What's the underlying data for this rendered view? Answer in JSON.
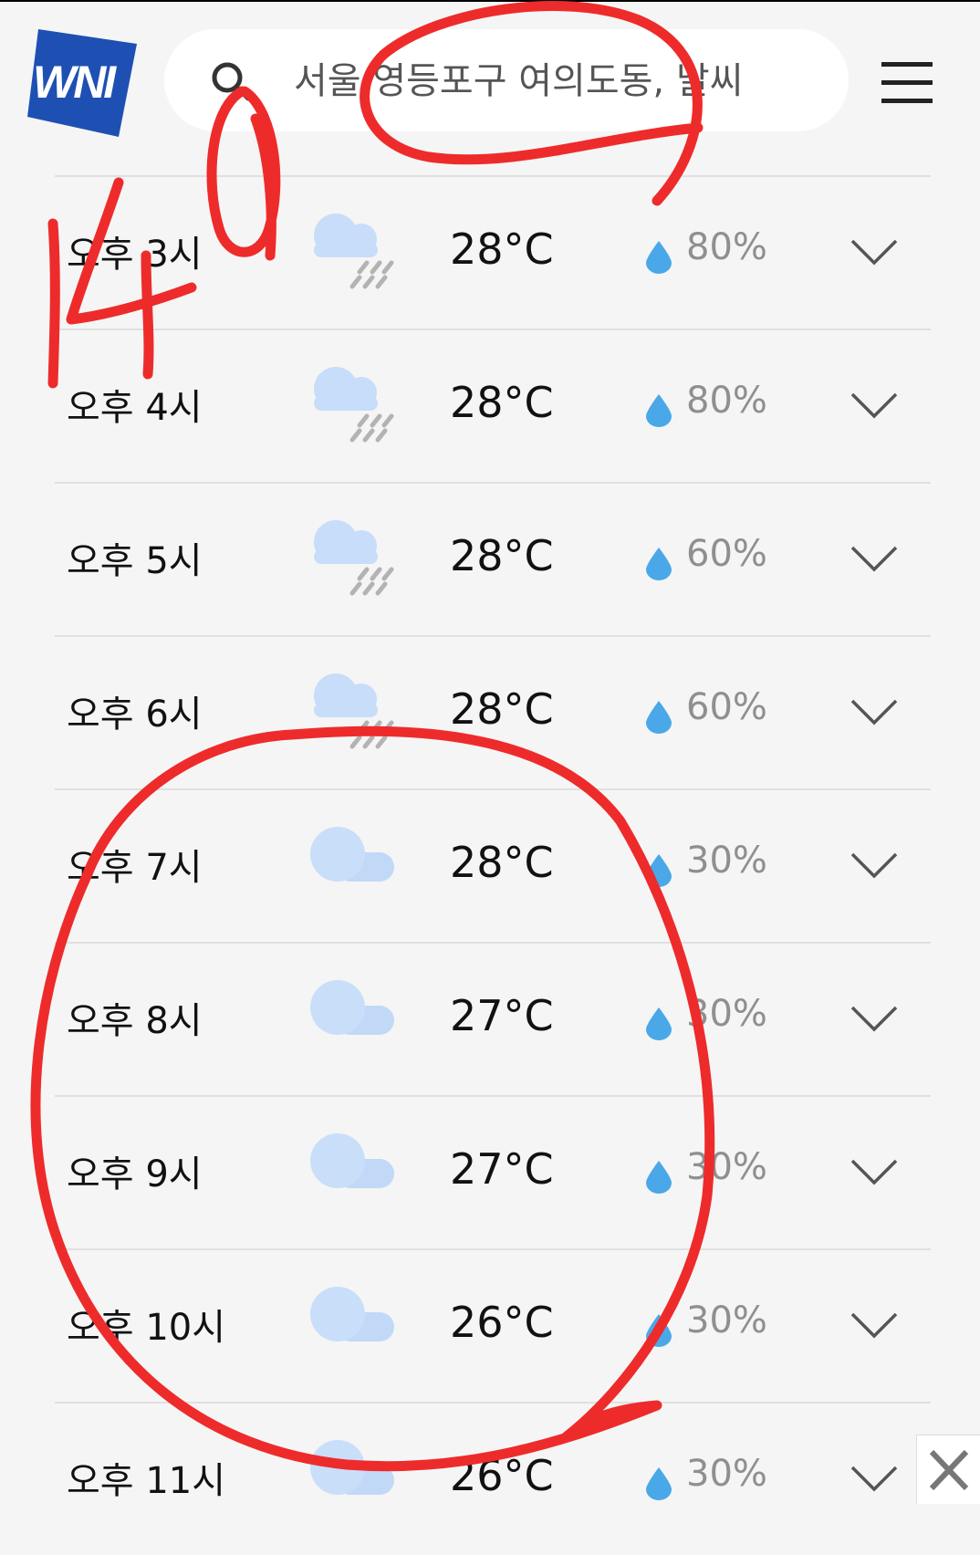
{
  "header": {
    "logo_text": "WNI",
    "search_placeholder": "서울 영등포구 여의도동, 날씨"
  },
  "hours": [
    {
      "time": "오후 3시",
      "icon": "cloud-rain-icon",
      "temp": "28°C",
      "precip": "80%"
    },
    {
      "time": "오후 4시",
      "icon": "cloud-rain-icon",
      "temp": "28°C",
      "precip": "80%"
    },
    {
      "time": "오후 5시",
      "icon": "cloud-rain-icon",
      "temp": "28°C",
      "precip": "60%"
    },
    {
      "time": "오후 6시",
      "icon": "cloud-rain-icon",
      "temp": "28°C",
      "precip": "60%"
    },
    {
      "time": "오후 7시",
      "icon": "cloud-icon",
      "temp": "28°C",
      "precip": "30%"
    },
    {
      "time": "오후 8시",
      "icon": "cloud-icon",
      "temp": "27°C",
      "precip": "30%"
    },
    {
      "time": "오후 9시",
      "icon": "cloud-icon",
      "temp": "27°C",
      "precip": "30%"
    },
    {
      "time": "오후 10시",
      "icon": "cloud-icon",
      "temp": "26°C",
      "precip": "30%"
    },
    {
      "time": "오후 11시",
      "icon": "cloud-icon",
      "temp": "26°C",
      "precip": "30%"
    }
  ],
  "annotation": {
    "handwritten_text": "14일",
    "color": "#ee2b2b"
  },
  "colors": {
    "brand_blue": "#1e50b4",
    "cloud": "#c7ddf9",
    "drop": "#4aa8e8",
    "rain_streak": "#b3b3b3"
  }
}
